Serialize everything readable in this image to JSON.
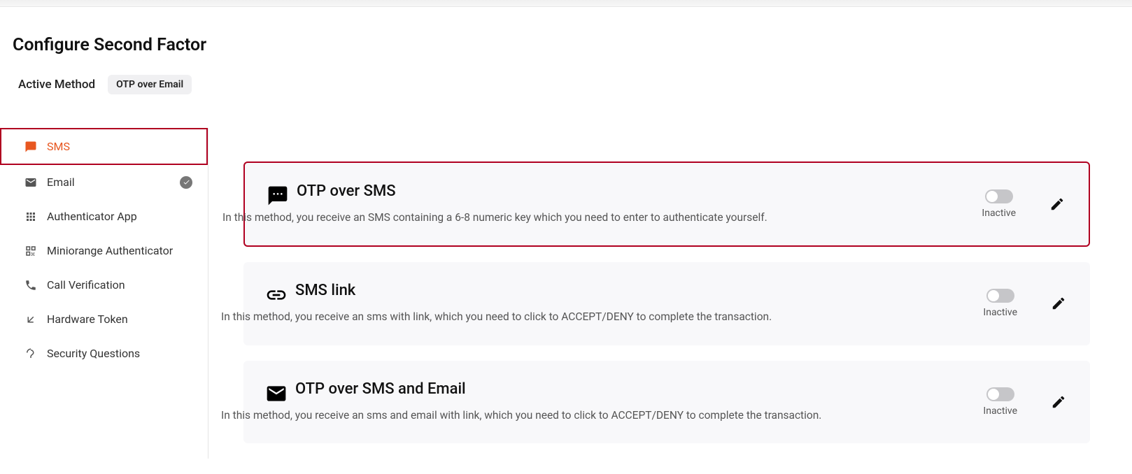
{
  "page_title": "Configure Second Factor",
  "active_method_label": "Active Method",
  "active_method_value": "OTP over Email",
  "sidebar": {
    "items": [
      {
        "key": "sms",
        "label": "SMS",
        "active": true
      },
      {
        "key": "email",
        "label": "Email",
        "checked": true
      },
      {
        "key": "authenticator-app",
        "label": "Authenticator App"
      },
      {
        "key": "miniorange-authenticator",
        "label": "Miniorange Authenticator"
      },
      {
        "key": "call-verification",
        "label": "Call Verification"
      },
      {
        "key": "hardware-token",
        "label": "Hardware Token"
      },
      {
        "key": "security-questions",
        "label": "Security Questions"
      }
    ]
  },
  "cards": [
    {
      "key": "otp-over-sms",
      "title": "OTP over SMS",
      "description": "In this method, you receive an SMS containing a 6-8 numeric key which you need to enter to authenticate yourself.",
      "status_label": "Inactive",
      "highlighted": true
    },
    {
      "key": "sms-link",
      "title": "SMS link",
      "description": "In this method, you receive an sms with link, which you need to click to ACCEPT/DENY to complete the transaction.",
      "status_label": "Inactive"
    },
    {
      "key": "otp-over-sms-and-email",
      "title": "OTP over SMS and Email",
      "description": "In this method, you receive an sms and email with link, which you need to click to ACCEPT/DENY to complete the transaction.",
      "status_label": "Inactive"
    }
  ]
}
